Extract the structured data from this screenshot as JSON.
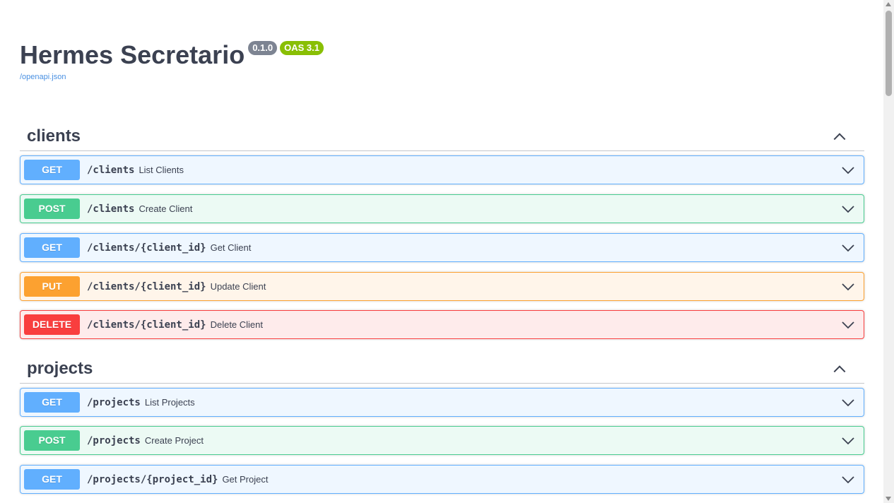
{
  "info": {
    "title": "Hermes Secretario",
    "version_badge": "0.1.0",
    "oas_badge": "OAS 3.1",
    "spec_link": "/openapi.json"
  },
  "sections": {
    "clients": {
      "name": "clients",
      "operations": [
        {
          "method": "GET",
          "path": "/clients",
          "summary": "List Clients"
        },
        {
          "method": "POST",
          "path": "/clients",
          "summary": "Create Client"
        },
        {
          "method": "GET",
          "path": "/clients/{client_id}",
          "summary": "Get Client"
        },
        {
          "method": "PUT",
          "path": "/clients/{client_id}",
          "summary": "Update Client"
        },
        {
          "method": "DELETE",
          "path": "/clients/{client_id}",
          "summary": "Delete Client"
        }
      ]
    },
    "projects": {
      "name": "projects",
      "operations": [
        {
          "method": "GET",
          "path": "/projects",
          "summary": "List Projects"
        },
        {
          "method": "POST",
          "path": "/projects",
          "summary": "Create Project"
        },
        {
          "method": "GET",
          "path": "/projects/{project_id}",
          "summary": "Get Project"
        }
      ]
    }
  },
  "icons": {
    "section_toggle": "chevron-up-icon",
    "operation_toggle": "chevron-down-icon"
  },
  "colors": {
    "get": "#61affe",
    "post": "#49cc90",
    "put": "#fca130",
    "delete": "#f93e3e",
    "version_badge": "#7d8492",
    "oas_badge": "#89bf04",
    "link": "#4990e2"
  }
}
